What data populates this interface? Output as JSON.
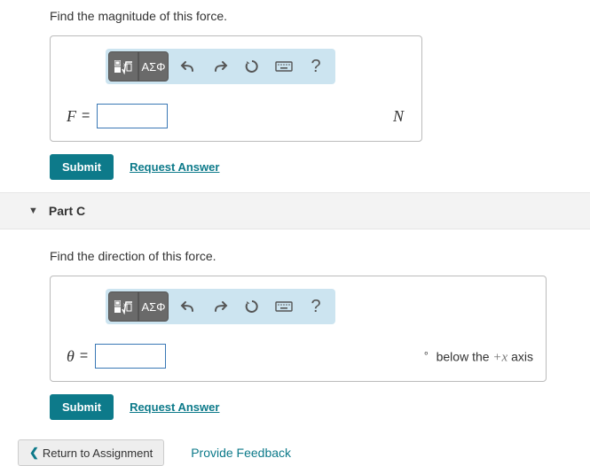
{
  "partB": {
    "question": "Find the magnitude of this force.",
    "variable": "F",
    "equals": "=",
    "unit": "N",
    "submit": "Submit",
    "request": "Request Answer"
  },
  "partC": {
    "header": "Part C",
    "question": "Find the direction of this force.",
    "variable": "θ",
    "equals": "=",
    "suffix_prefix": "below the ",
    "suffix_var": "+x",
    "suffix_post": " axis",
    "submit": "Submit",
    "request": "Request Answer"
  },
  "toolbar": {
    "templates_label": "x√",
    "greek_label": "ΑΣΦ"
  },
  "footer": {
    "return": "Return to Assignment",
    "feedback": "Provide Feedback"
  }
}
